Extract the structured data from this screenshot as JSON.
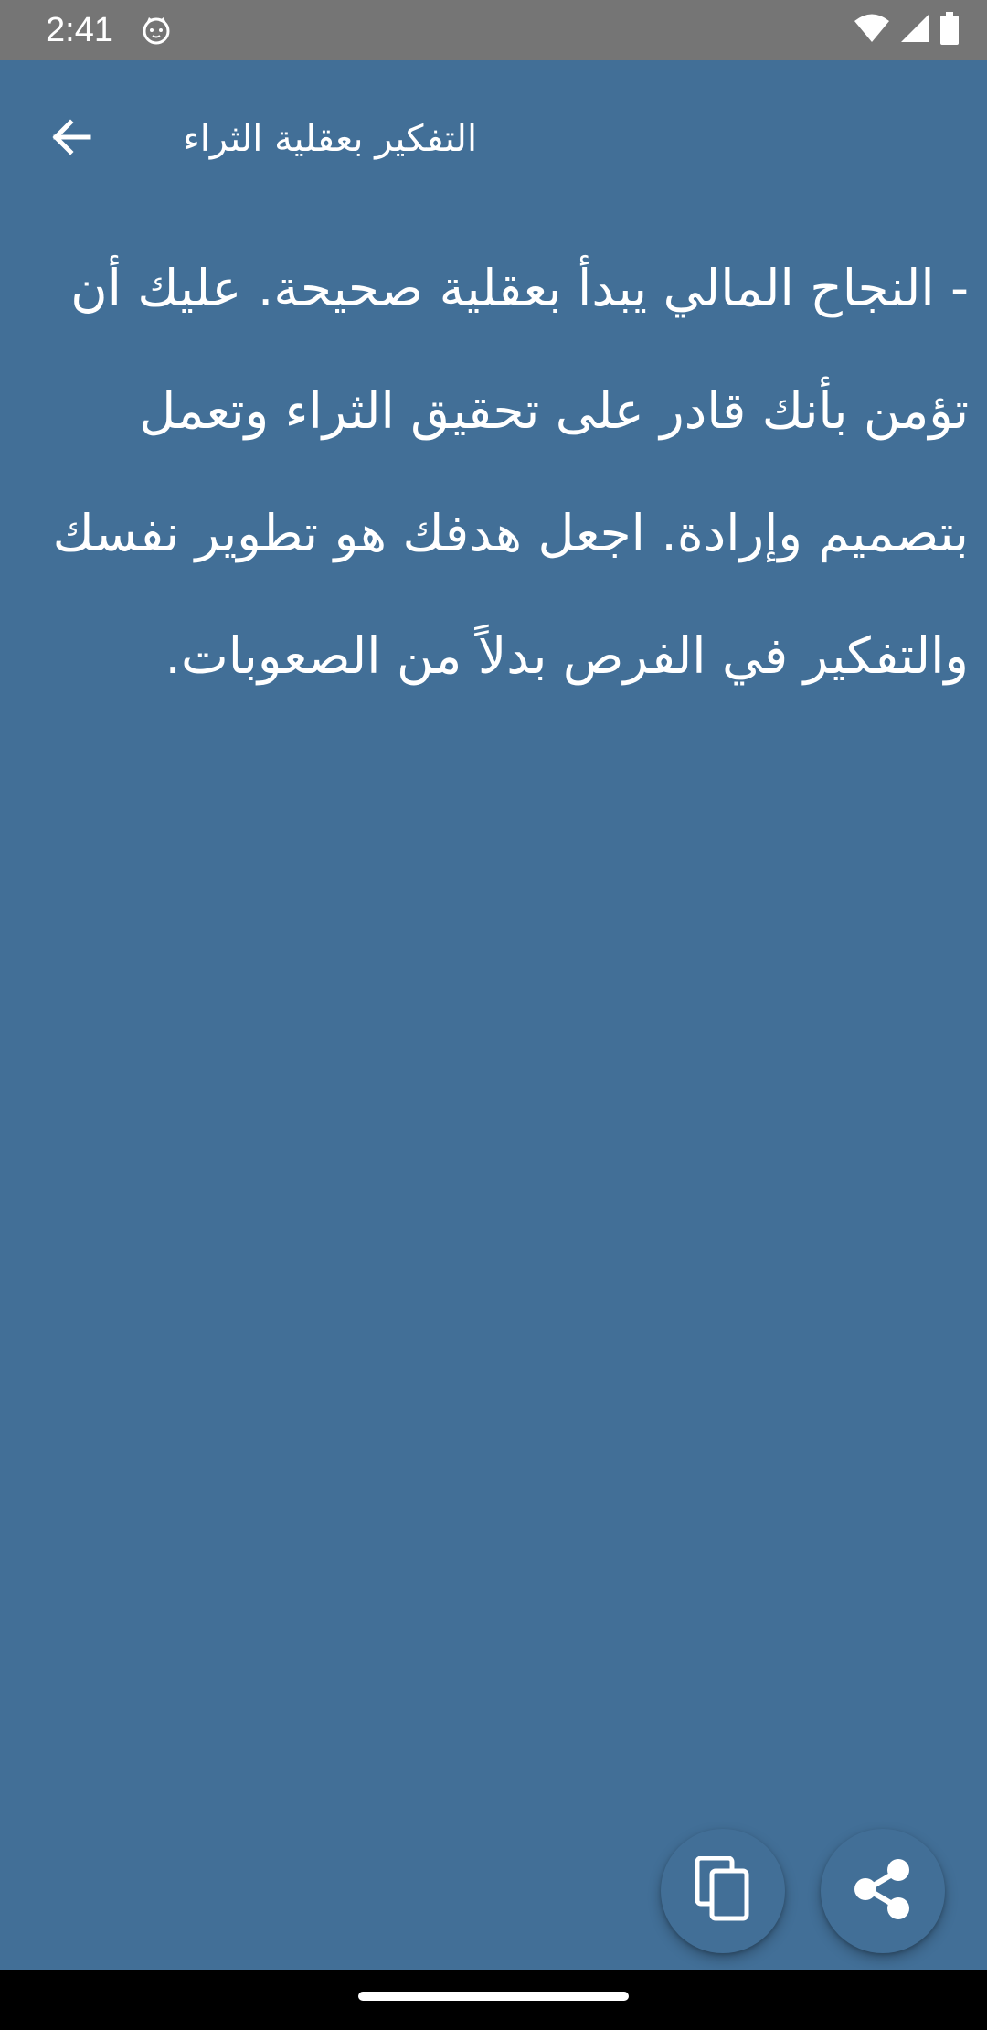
{
  "status_bar": {
    "time": "2:41",
    "app_icon": "cat-icon",
    "icons": [
      "wifi-icon",
      "signal-icon",
      "battery-icon"
    ]
  },
  "app_bar": {
    "back_icon": "arrow-back-icon",
    "title": "التفكير بعقلية الثراء"
  },
  "content": {
    "text": "- النجاح المالي يبدأ بعقلية صحيحة. عليك أن تؤمن بأنك قادر على تحقيق الثراء وتعمل بتصميم وإرادة. اجعل هدفك هو تطوير نفسك والتفكير في الفرص بدلاً من الصعوبات."
  },
  "actions": {
    "copy_icon": "copy-icon",
    "share_icon": "share-icon"
  },
  "colors": {
    "background": "#426f97",
    "status_bar": "#757575",
    "text": "#ffffff",
    "nav_bar": "#000000"
  }
}
